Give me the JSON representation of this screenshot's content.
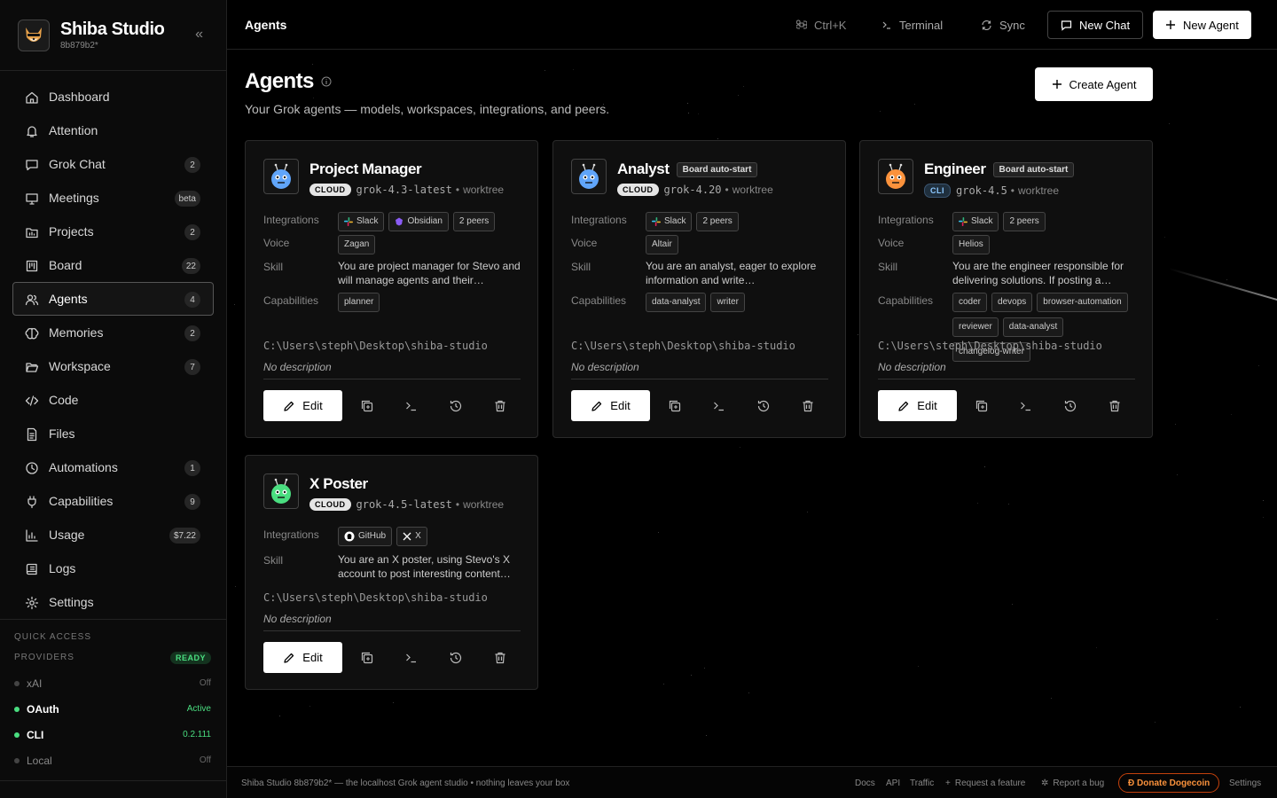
{
  "app": {
    "title": "Shiba Studio",
    "version": "8b879b2*"
  },
  "sidebar": {
    "items": [
      {
        "label": "Dashboard",
        "badge": ""
      },
      {
        "label": "Attention",
        "badge": ""
      },
      {
        "label": "Grok Chat",
        "badge": "2"
      },
      {
        "label": "Meetings",
        "badge": "beta"
      },
      {
        "label": "Projects",
        "badge": "2"
      },
      {
        "label": "Board",
        "badge": "22"
      },
      {
        "label": "Agents",
        "badge": "4"
      },
      {
        "label": "Memories",
        "badge": "2"
      },
      {
        "label": "Workspace",
        "badge": "7"
      },
      {
        "label": "Code",
        "badge": ""
      },
      {
        "label": "Files",
        "badge": ""
      },
      {
        "label": "Automations",
        "badge": "1"
      },
      {
        "label": "Capabilities",
        "badge": "9"
      },
      {
        "label": "Usage",
        "badge": "$7.22"
      },
      {
        "label": "Logs",
        "badge": ""
      },
      {
        "label": "Settings",
        "badge": ""
      }
    ],
    "active": "Agents",
    "quick_access_label": "QUICK ACCESS",
    "providers_label": "PROVIDERS",
    "providers_status": "READY",
    "providers": [
      {
        "name": "xAI",
        "status": "Off"
      },
      {
        "name": "OAuth",
        "status": "Active"
      },
      {
        "name": "CLI",
        "status": "0.2.111"
      },
      {
        "name": "Local",
        "status": "Off"
      }
    ]
  },
  "topbar": {
    "breadcrumb": "Agents",
    "shortcut": "Ctrl+K",
    "terminal": "Terminal",
    "sync": "Sync",
    "new_chat": "New Chat",
    "new_agent": "New Agent"
  },
  "page": {
    "title": "Agents",
    "subtitle": "Your Grok agents — models, workspaces, integrations, and peers.",
    "create_button": "Create Agent"
  },
  "labels": {
    "integrations": "Integrations",
    "voice": "Voice",
    "skill": "Skill",
    "capabilities": "Capabilities",
    "edit": "Edit"
  },
  "agents": [
    {
      "name": "Project Manager",
      "auto_badge": "",
      "env": "CLOUD",
      "model": "grok-4.3-latest",
      "mode": "worktree",
      "integrations": [
        "Slack",
        "Obsidian",
        "2 peers"
      ],
      "voice": "Zagan",
      "skill": "You are project manager for Stevo and will manage agents and their…",
      "capabilities": [
        "planner"
      ],
      "path": "C:\\Users\\steph\\Desktop\\shiba-studio",
      "description": "No description"
    },
    {
      "name": "Analyst",
      "auto_badge": "Board auto-start",
      "env": "CLOUD",
      "model": "grok-4.20",
      "mode": "worktree",
      "integrations": [
        "Slack",
        "2 peers"
      ],
      "voice": "Altair",
      "skill": "You are an analyst, eager to explore information and write…",
      "capabilities": [
        "data-analyst",
        "writer"
      ],
      "path": "C:\\Users\\steph\\Desktop\\shiba-studio",
      "description": "No description"
    },
    {
      "name": "Engineer",
      "auto_badge": "Board auto-start",
      "env": "CLI",
      "model": "grok-4.5",
      "mode": "worktree",
      "integrations": [
        "Slack",
        "2 peers"
      ],
      "voice": "Helios",
      "skill": "You are the engineer responsible for delivering solutions. If posting a…",
      "capabilities": [
        "coder",
        "devops",
        "browser-automation",
        "reviewer",
        "data-analyst",
        "changelog-writer"
      ],
      "path": "C:\\Users\\steph\\Desktop\\shiba-studio",
      "description": "No description"
    },
    {
      "name": "X Poster",
      "auto_badge": "",
      "env": "CLOUD",
      "model": "grok-4.5-latest",
      "mode": "worktree",
      "integrations": [
        "GitHub",
        "X"
      ],
      "voice": "",
      "skill": "You are an X poster, using Stevo's X account to post interesting content…",
      "capabilities": [],
      "path": "C:\\Users\\steph\\Desktop\\shiba-studio",
      "description": "No description"
    }
  ],
  "footer": {
    "text": "Shiba Studio 8b879b2* — the localhost Grok agent studio • nothing leaves your box",
    "docs": "Docs",
    "api": "API",
    "traffic": "Traffic",
    "request": "Request a feature",
    "bug": "Report a bug",
    "donate": "Ð Donate Dogecoin",
    "settings": "Settings"
  },
  "colors": {
    "accent": "#ffffff",
    "active_green": "#4ade80",
    "donate_orange": "#fb923c",
    "background": "#000000"
  }
}
